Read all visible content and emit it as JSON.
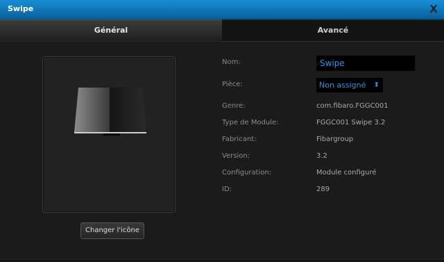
{
  "window": {
    "title": "Swipe",
    "close_label": "X"
  },
  "tabs": [
    {
      "label": "Général",
      "active": true
    },
    {
      "label": "Avancé",
      "active": false
    }
  ],
  "preview": {
    "icon": "swipe-device-icon",
    "change_button": "Changer l'icône"
  },
  "fields": {
    "name": {
      "label": "Nom:",
      "value": "Swipe"
    },
    "room": {
      "label": "Pièce:",
      "value": "Non assigné"
    },
    "genre": {
      "label": "Genre:",
      "value": "com.fibaro.FGGC001"
    },
    "module_type": {
      "label": "Type de Module:",
      "value": "FGGC001 Swipe 3.2"
    },
    "manufacturer": {
      "label": "Fabricant:",
      "value": "Fibargroup"
    },
    "version": {
      "label": "Version:",
      "value": "3.2"
    },
    "configuration": {
      "label": "Configuration:",
      "value": "Module configuré"
    },
    "id": {
      "label": "ID:",
      "value": "289"
    }
  },
  "colors": {
    "titlebar": "#0a6fb8",
    "accent": "#2e8ee0",
    "background": "#1b1b1b"
  }
}
